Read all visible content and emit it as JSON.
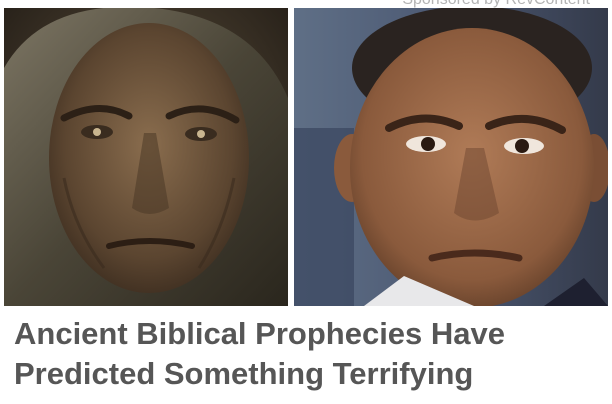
{
  "ad": {
    "sponsor_label": "Sponsored by RevContent",
    "headline_lines": [
      "Ancient Biblical Prophecies Have",
      "Predicted Something Terrifying"
    ]
  },
  "images": {
    "left": {
      "subject": "hooded-figure-portrait"
    },
    "right": {
      "subject": "man-in-suit-portrait"
    }
  },
  "colors": {
    "headline": "#565656",
    "sponsor": "#b4b4b4",
    "background": "#ffffff"
  }
}
